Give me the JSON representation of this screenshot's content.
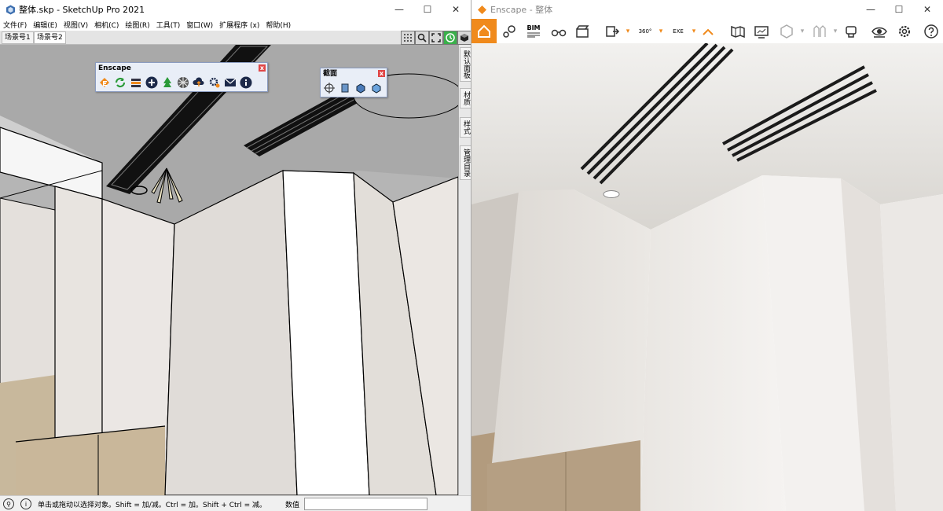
{
  "sketchup": {
    "title": "整体.skp - SketchUp Pro 2021",
    "menu": [
      "文件(F)",
      "编辑(E)",
      "视图(V)",
      "相机(C)",
      "绘图(R)",
      "工具(T)",
      "窗口(W)",
      "扩展程序 (x)",
      "帮助(H)"
    ],
    "scenes": [
      "场景号1",
      "场景号2"
    ],
    "enscape_panel": {
      "title": "Enscape",
      "close": "x"
    },
    "section_panel": {
      "title": "截面",
      "close": "x"
    },
    "trays": [
      "默认面板",
      "材质",
      "样式",
      "管理目录"
    ],
    "status_text": "单击或拖动以选择对象。Shift = 加/减。Ctrl = 加。Shift + Ctrl = 减。",
    "measure_label": "数值",
    "measure_value": ""
  },
  "enscape": {
    "title": "Enscape - 整体",
    "toolbar_text": {
      "bim": "BIM",
      "pano": "360°",
      "exe": "EXE"
    }
  },
  "colors": {
    "enscape_orange": "#f08a1c",
    "accent_green": "#39b04a",
    "ceiling_gray": "#a7a7a7",
    "wall_white": "#eeeeee"
  }
}
